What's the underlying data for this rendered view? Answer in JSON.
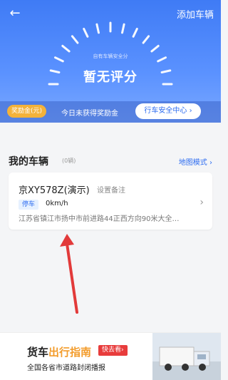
{
  "header": {
    "add_car": "添加车辆",
    "gauge_subtitle": "自有车辆安全分",
    "gauge_value": "暂无评分",
    "reward_badge": "奖励金(元)",
    "reward_text": "今日未获得奖励金",
    "safety_center": "行车安全中心 ›"
  },
  "section": {
    "title": "我的车辆",
    "count": "(0辆)",
    "map_mode": "地图模式 ›"
  },
  "vehicle": {
    "plate": "京XY578Z(演示)",
    "remark": "设置备注",
    "status": "停车",
    "speed": "0km/h",
    "address": "江苏省镇江市扬中市前进路44正西方向90米大全…"
  },
  "banner": {
    "title_a": "货车",
    "title_b": "出行指南",
    "go": "快去看›",
    "subtitle": "全国各省市道路封闭播报"
  }
}
